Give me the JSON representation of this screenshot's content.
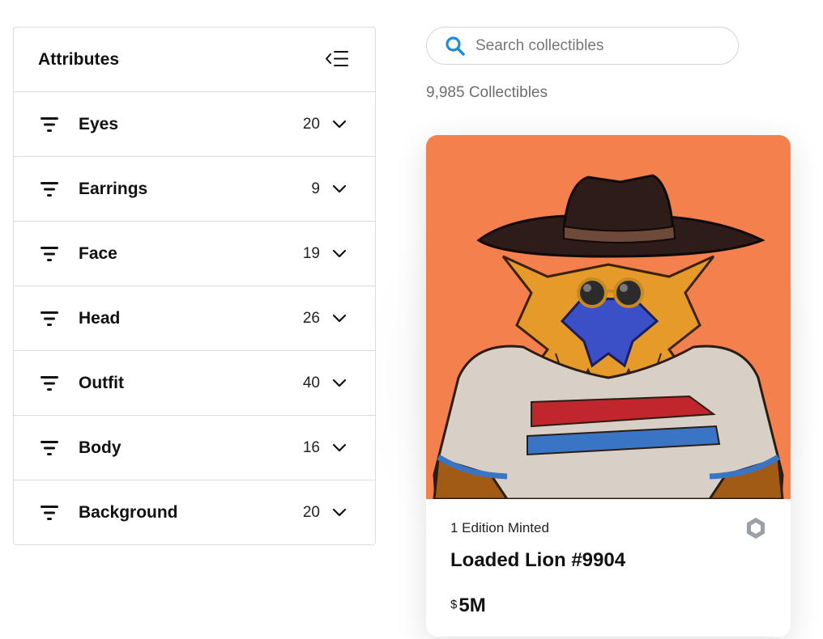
{
  "sidebar": {
    "title": "Attributes",
    "items": [
      {
        "label": "Eyes",
        "count": "20"
      },
      {
        "label": "Earrings",
        "count": "9"
      },
      {
        "label": "Face",
        "count": "19"
      },
      {
        "label": "Head",
        "count": "26"
      },
      {
        "label": "Outfit",
        "count": "40"
      },
      {
        "label": "Body",
        "count": "16"
      },
      {
        "label": "Background",
        "count": "20"
      }
    ]
  },
  "search": {
    "placeholder": "Search collectibles",
    "value": ""
  },
  "results": {
    "count_label": "9,985 Collectibles"
  },
  "card": {
    "edition": "1 Edition Minted",
    "name": "Loaded Lion #9904",
    "price_currency": "$",
    "price_value": "5M",
    "image_background": "#f4804d"
  },
  "colors": {
    "accent": "#1a8fd6",
    "border": "#dcdcdc"
  },
  "icons": [
    "collapse-sidebar-icon",
    "filter-icon",
    "chevron-down-icon",
    "search-icon",
    "blockchain-icon"
  ]
}
